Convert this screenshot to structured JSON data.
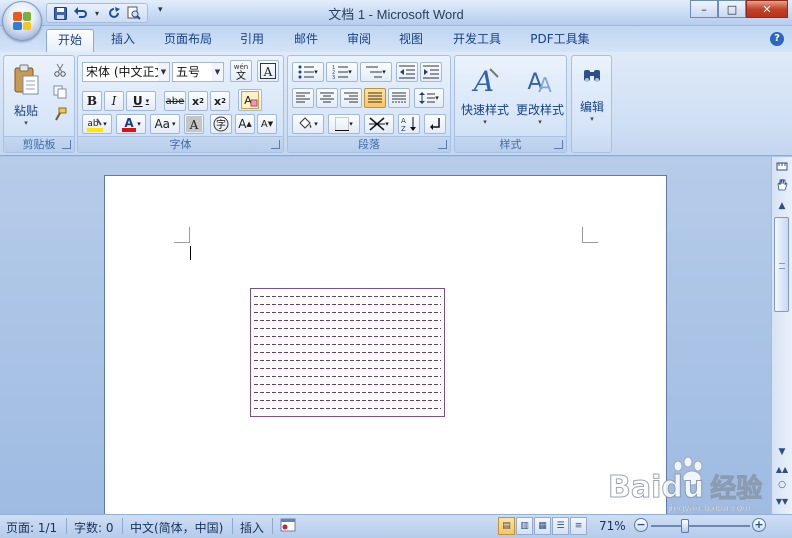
{
  "window": {
    "title": "文档 1 - Microsoft Word",
    "controls": {
      "minimize": "–",
      "maximize": "□",
      "close": "✕"
    }
  },
  "quick_access": {
    "save_icon": "save-icon",
    "undo_icon": "undo-icon",
    "redo_icon": "redo-icon",
    "preview_icon": "print-preview-icon"
  },
  "tabs": [
    "开始",
    "插入",
    "页面布局",
    "引用",
    "邮件",
    "审阅",
    "视图",
    "开发工具",
    "PDF工具集"
  ],
  "active_tab": "开始",
  "ribbon": {
    "clipboard": {
      "label": "剪贴板",
      "paste": "粘贴"
    },
    "font": {
      "label": "字体",
      "font_name": "宋体 (中文正文",
      "font_size": "五号",
      "change_case": "Aa"
    },
    "paragraph": {
      "label": "段落"
    },
    "styles": {
      "label": "样式",
      "quick_styles": "快速样式",
      "change_styles": "更改样式"
    },
    "editing": {
      "label": "编辑"
    }
  },
  "document": {
    "shape": "text-box"
  },
  "status": {
    "page": "页面: 1/1",
    "words": "字数: 0",
    "language": "中文(简体，中国)",
    "mode": "插入",
    "zoom": "71%",
    "zoom_level": 0.71
  },
  "watermark": {
    "brand": "Baidu",
    "text": "经验",
    "url": "jingyan.baidu.com"
  },
  "colors": {
    "accent": "#15428b",
    "ribbon": "#dfeaf8",
    "highlight": "#ffe700",
    "font_color": "#e01010"
  }
}
